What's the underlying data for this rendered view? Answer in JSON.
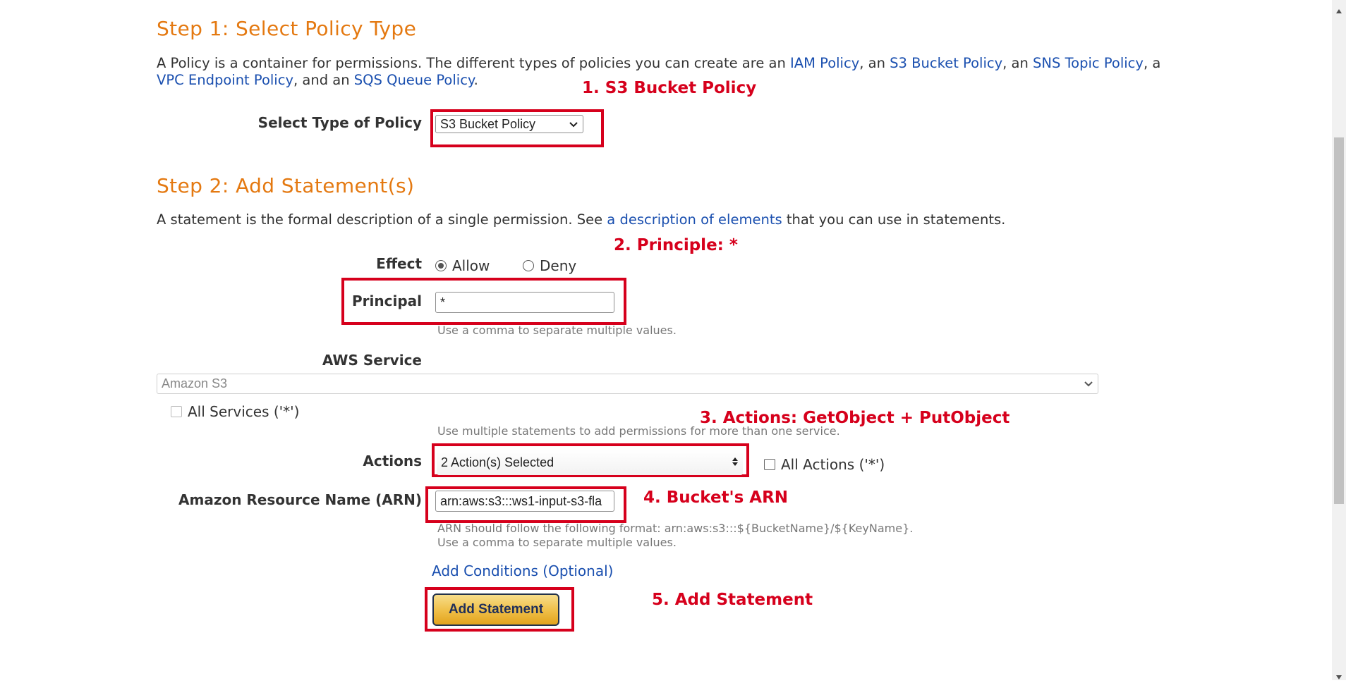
{
  "step1": {
    "title": "Step 1: Select Policy Type",
    "desc": {
      "t1": "A Policy is a container for permissions. The different types of policies you can create are an ",
      "link_iam": "IAM Policy",
      "t2": ", an ",
      "link_s3": "S3 Bucket Policy",
      "t3": ", an ",
      "link_sns": "SNS Topic Policy",
      "t4": ", a",
      "link_vpc": "VPC Endpoint Policy",
      "t5": ", and an ",
      "link_sqs": "SQS Queue Policy",
      "t6": "."
    },
    "policy_type_label": "Select Type of Policy",
    "policy_type_value": "S3 Bucket Policy"
  },
  "step2": {
    "title": "Step 2: Add Statement(s)",
    "desc": {
      "t1": "A statement is the formal description of a single permission. See ",
      "link": "a description of elements",
      "t2": " that you can use in statements."
    },
    "effect_label": "Effect",
    "effect_allow": "Allow",
    "effect_deny": "Deny",
    "principal_label": "Principal",
    "principal_value": "*",
    "principal_hint": "Use a comma to separate multiple values.",
    "service_label": "AWS Service",
    "service_value": "Amazon S3",
    "all_services_label": "All Services ('*')",
    "service_hint": "Use multiple statements to add permissions for more than one service.",
    "actions_label": "Actions",
    "actions_value": "2 Action(s) Selected",
    "all_actions_label": "All Actions ('*')",
    "arn_label": "Amazon Resource Name (ARN)",
    "arn_value": "arn:aws:s3:::ws1-input-s3-fla",
    "arn_hint1": "ARN should follow the following format: arn:aws:s3:::${BucketName}/${KeyName}.",
    "arn_hint2": "Use a comma to separate multiple values.",
    "add_conditions": "Add Conditions (Optional)",
    "add_statement": "Add Statement"
  },
  "annotations": {
    "a1": "1. S3 Bucket Policy",
    "a2": "2. Principle: *",
    "a3": "3. Actions: GetObject + PutObject",
    "a4": "4. Bucket's ARN",
    "a5": "5. Add Statement"
  },
  "colors": {
    "step_title": "#e47911",
    "link": "#1a4faf",
    "annotation": "#d6001c",
    "button": "#f0c14b"
  }
}
